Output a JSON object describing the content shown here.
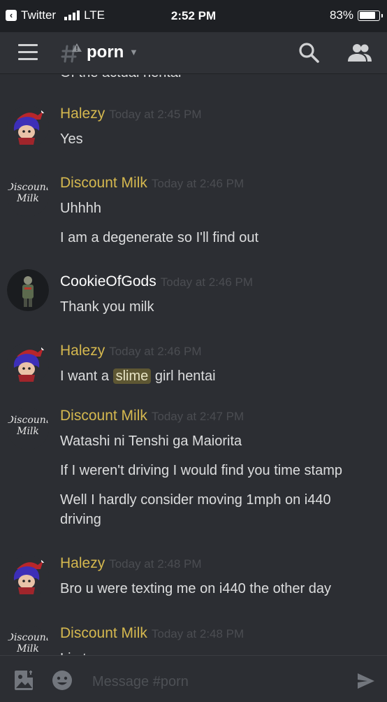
{
  "status_bar": {
    "back_app": "Twitter",
    "network": "LTE",
    "time": "2:52 PM",
    "battery": "83%",
    "battery_level": 0.83
  },
  "header": {
    "channel_name": "porn",
    "icons": [
      "menu-icon",
      "nsfw-channel-icon",
      "search-icon",
      "members-icon"
    ]
  },
  "messages": {
    "cutoff_text": "Of the actual hentai",
    "groups": [
      {
        "author": "Halezy",
        "timestamp": "Today at 2:45 PM",
        "lines": [
          "Yes"
        ]
      },
      {
        "author": "Discount Milk",
        "timestamp": "Today at 2:46 PM",
        "lines": [
          "Uhhhh",
          "I am a degenerate so I'll find out"
        ]
      },
      {
        "author": "CookieOfGods",
        "timestamp": "Today at 2:46 PM",
        "lines": [
          "Thank you milk"
        ]
      },
      {
        "author": "Halezy",
        "timestamp": "Today at 2:46 PM",
        "lines_parts": [
          "I want a ",
          "slime",
          " girl hentai"
        ]
      },
      {
        "author": "Discount Milk",
        "timestamp": "Today at 2:47 PM",
        "lines": [
          "Watashi ni Tenshi ga Maiorita",
          "If I weren't driving I would find you time stamp",
          "Well I hardly consider moving 1mph on i440 driving"
        ]
      },
      {
        "author": "Halezy",
        "timestamp": "Today at 2:48 PM",
        "lines": [
          "Bro u were texting me on i440 the other day"
        ]
      },
      {
        "author": "Discount Milk",
        "timestamp": "Today at 2:48 PM",
        "lines": [
          "Lie to me some more"
        ]
      }
    ],
    "avatar_text": {
      "discount_milk": [
        "Discount",
        "Milk"
      ]
    }
  },
  "composer": {
    "placeholder": "Message #porn"
  },
  "colors": {
    "background": "#2c2e33",
    "header": "#2f3136",
    "username_gold": "#d5b84f",
    "timestamp": "#4b4d52",
    "highlight": "#5e5733"
  }
}
